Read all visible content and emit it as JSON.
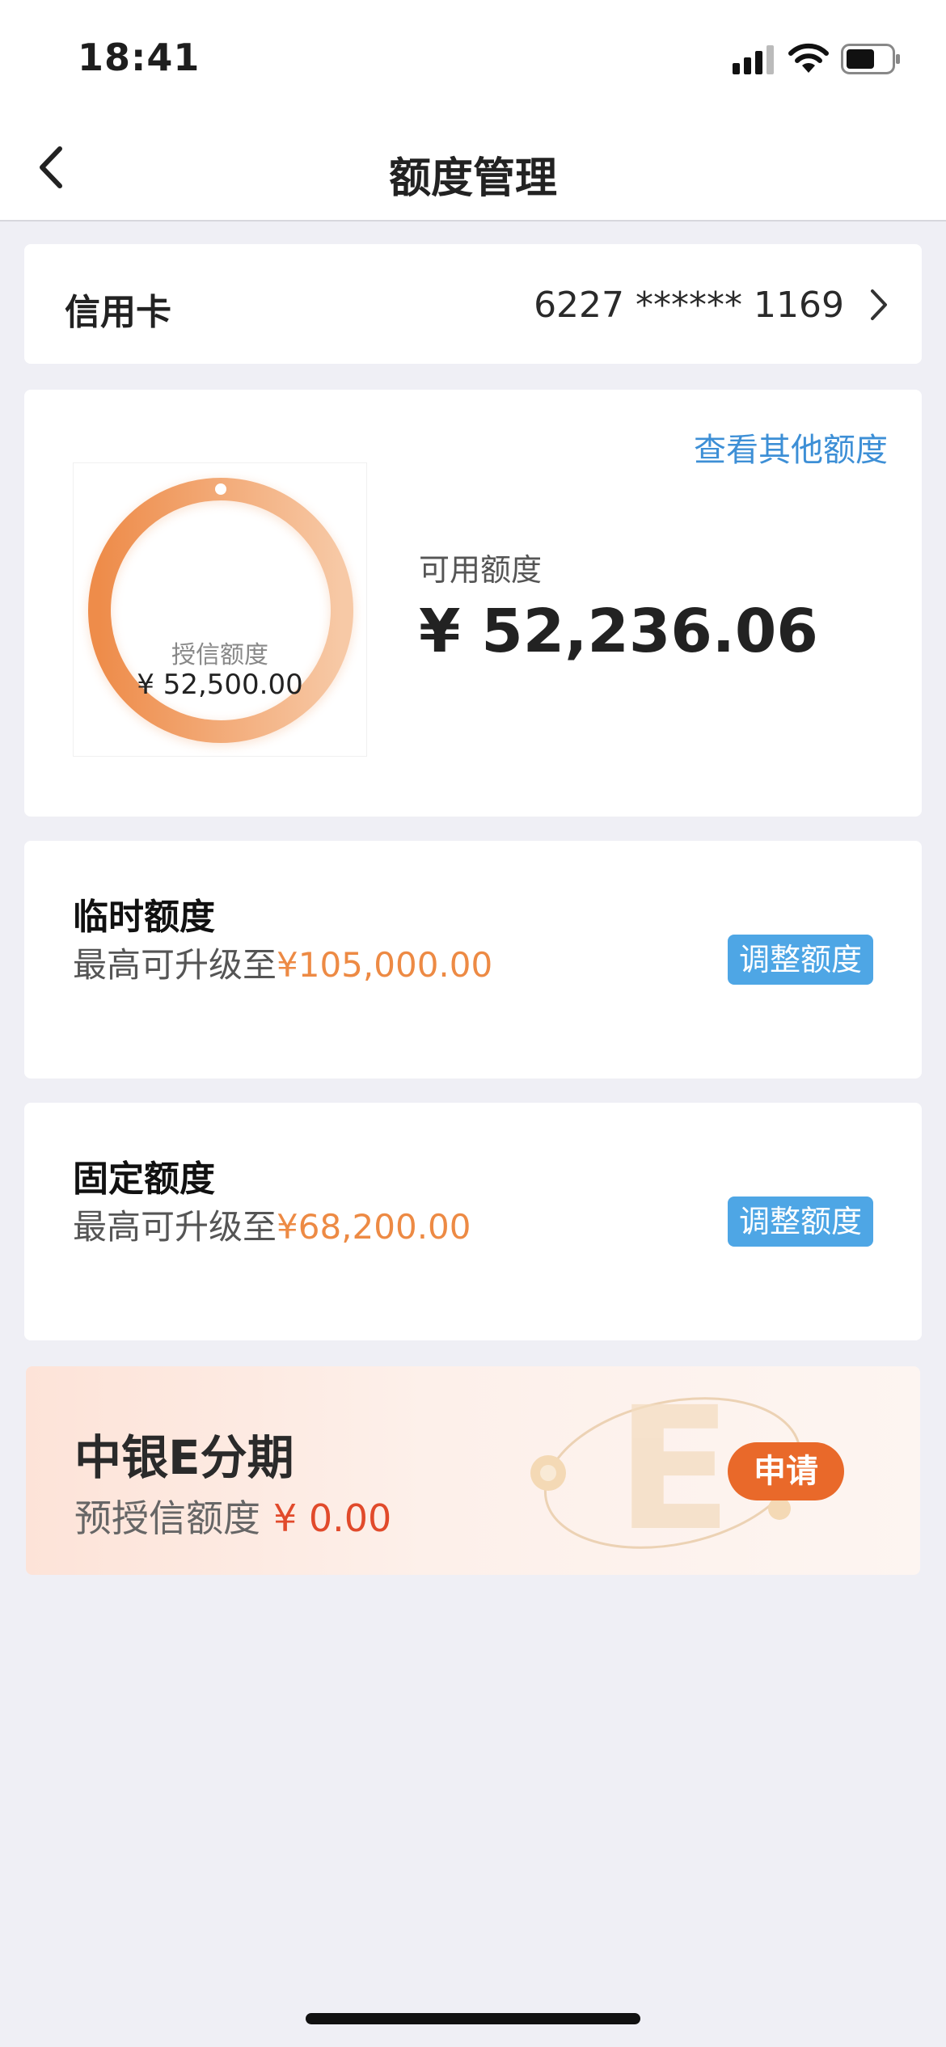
{
  "status_bar": {
    "time": "18:41",
    "icons": [
      "signal-icon",
      "wifi-icon",
      "battery-icon"
    ]
  },
  "nav": {
    "title": "额度管理",
    "back_icon": "chevron-left-icon"
  },
  "card_row": {
    "label": "信用卡",
    "number": "6227 ****** 1169",
    "chevron_icon": "chevron-right-icon"
  },
  "credit": {
    "view_other": "查看其他额度",
    "granted_label": "授信额度",
    "granted_value": "¥ 52,500.00",
    "available_label": "可用额度",
    "available_value": "¥ 52,236.06"
  },
  "temp_quota": {
    "title": "临时额度",
    "desc_prefix": "最高可升级至",
    "amount": "¥105,000.00",
    "button": "调整额度"
  },
  "fixed_quota": {
    "title": "固定额度",
    "desc_prefix": "最高可升级至",
    "amount": "¥68,200.00",
    "button": "调整额度"
  },
  "installment": {
    "title": "中银E分期",
    "desc_prefix": "预授信额度",
    "amount": "¥ 0.00",
    "button": "申请",
    "decoration_letter": "E"
  },
  "colors": {
    "accent_blue": "#4ea6e5",
    "link_blue": "#3d8fd6",
    "orange": "#ed8a44",
    "apply_orange": "#e9692a",
    "red": "#e14a2b"
  }
}
